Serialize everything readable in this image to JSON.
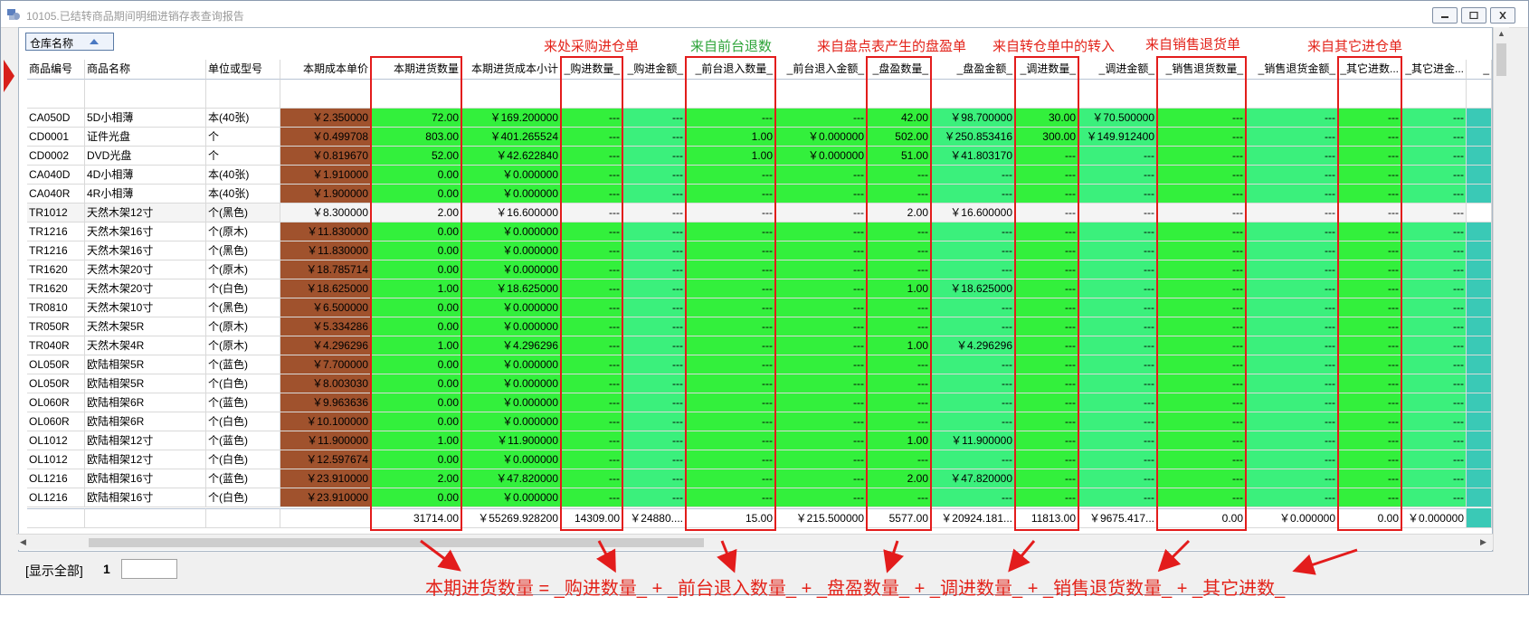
{
  "window": {
    "title": "10105.已结转商品期间明细进销存表查询报告"
  },
  "group_bar": {
    "label": "仓库名称"
  },
  "columns": [
    "商品编号",
    "商品名称",
    "单位或型号",
    "本期成本单价",
    "本期进货数量",
    "本期进货成本小计",
    "_购进数量_",
    "_购进金额_",
    "_前台退入数量_",
    "_前台退入金额_",
    "_盘盈数量_",
    "_盘盈金额_",
    "_调进数量_",
    "_调进金额_",
    "_销售退货数量_",
    "_销售退货金额_",
    "_其它进数...",
    "_其它进金...",
    "_"
  ],
  "rows": [
    [
      "CA050D",
      "5D小相薄",
      "本(40张)",
      "￥2.350000",
      "72.00",
      "￥169.200000",
      "---",
      "---",
      "---",
      "---",
      "42.00",
      "￥98.700000",
      "30.00",
      "￥70.500000",
      "---",
      "---",
      "---",
      "---"
    ],
    [
      "CD0001",
      "证件光盘",
      "个",
      "￥0.499708",
      "803.00",
      "￥401.265524",
      "---",
      "---",
      "1.00",
      "￥0.000000",
      "502.00",
      "￥250.853416",
      "300.00",
      "￥149.912400",
      "---",
      "---",
      "---",
      "---"
    ],
    [
      "CD0002",
      "DVD光盘",
      "个",
      "￥0.819670",
      "52.00",
      "￥42.622840",
      "---",
      "---",
      "1.00",
      "￥0.000000",
      "51.00",
      "￥41.803170",
      "---",
      "---",
      "---",
      "---",
      "---",
      "---"
    ],
    [
      "CA040D",
      "4D小相薄",
      "本(40张)",
      "￥1.910000",
      "0.00",
      "￥0.000000",
      "---",
      "---",
      "---",
      "---",
      "---",
      "---",
      "---",
      "---",
      "---",
      "---",
      "---",
      "---"
    ],
    [
      "CA040R",
      "4R小相薄",
      "本(40张)",
      "￥1.900000",
      "0.00",
      "￥0.000000",
      "---",
      "---",
      "---",
      "---",
      "---",
      "---",
      "---",
      "---",
      "---",
      "---",
      "---",
      "---"
    ],
    [
      "TR1012",
      "天然木架12寸",
      "个(黑色)",
      "￥8.300000",
      "2.00",
      "￥16.600000",
      "---",
      "---",
      "---",
      "---",
      "2.00",
      "￥16.600000",
      "---",
      "---",
      "---",
      "---",
      "---",
      "---"
    ],
    [
      "TR1216",
      "天然木架16寸",
      "个(原木)",
      "￥11.830000",
      "0.00",
      "￥0.000000",
      "---",
      "---",
      "---",
      "---",
      "---",
      "---",
      "---",
      "---",
      "---",
      "---",
      "---",
      "---"
    ],
    [
      "TR1216",
      "天然木架16寸",
      "个(黑色)",
      "￥11.830000",
      "0.00",
      "￥0.000000",
      "---",
      "---",
      "---",
      "---",
      "---",
      "---",
      "---",
      "---",
      "---",
      "---",
      "---",
      "---"
    ],
    [
      "TR1620",
      "天然木架20寸",
      "个(原木)",
      "￥18.785714",
      "0.00",
      "￥0.000000",
      "---",
      "---",
      "---",
      "---",
      "---",
      "---",
      "---",
      "---",
      "---",
      "---",
      "---",
      "---"
    ],
    [
      "TR1620",
      "天然木架20寸",
      "个(白色)",
      "￥18.625000",
      "1.00",
      "￥18.625000",
      "---",
      "---",
      "---",
      "---",
      "1.00",
      "￥18.625000",
      "---",
      "---",
      "---",
      "---",
      "---",
      "---"
    ],
    [
      "TR0810",
      "天然木架10寸",
      "个(黑色)",
      "￥6.500000",
      "0.00",
      "￥0.000000",
      "---",
      "---",
      "---",
      "---",
      "---",
      "---",
      "---",
      "---",
      "---",
      "---",
      "---",
      "---"
    ],
    [
      "TR050R",
      "天然木架5R",
      "个(原木)",
      "￥5.334286",
      "0.00",
      "￥0.000000",
      "---",
      "---",
      "---",
      "---",
      "---",
      "---",
      "---",
      "---",
      "---",
      "---",
      "---",
      "---"
    ],
    [
      "TR040R",
      "天然木架4R",
      "个(原木)",
      "￥4.296296",
      "1.00",
      "￥4.296296",
      "---",
      "---",
      "---",
      "---",
      "1.00",
      "￥4.296296",
      "---",
      "---",
      "---",
      "---",
      "---",
      "---"
    ],
    [
      "OL050R",
      "欧陆相架5R",
      "个(蓝色)",
      "￥7.700000",
      "0.00",
      "￥0.000000",
      "---",
      "---",
      "---",
      "---",
      "---",
      "---",
      "---",
      "---",
      "---",
      "---",
      "---",
      "---"
    ],
    [
      "OL050R",
      "欧陆相架5R",
      "个(白色)",
      "￥8.003030",
      "0.00",
      "￥0.000000",
      "---",
      "---",
      "---",
      "---",
      "---",
      "---",
      "---",
      "---",
      "---",
      "---",
      "---",
      "---"
    ],
    [
      "OL060R",
      "欧陆相架6R",
      "个(蓝色)",
      "￥9.963636",
      "0.00",
      "￥0.000000",
      "---",
      "---",
      "---",
      "---",
      "---",
      "---",
      "---",
      "---",
      "---",
      "---",
      "---",
      "---"
    ],
    [
      "OL060R",
      "欧陆相架6R",
      "个(白色)",
      "￥10.100000",
      "0.00",
      "￥0.000000",
      "---",
      "---",
      "---",
      "---",
      "---",
      "---",
      "---",
      "---",
      "---",
      "---",
      "---",
      "---"
    ],
    [
      "OL1012",
      "欧陆相架12寸",
      "个(蓝色)",
      "￥11.900000",
      "1.00",
      "￥11.900000",
      "---",
      "---",
      "---",
      "---",
      "1.00",
      "￥11.900000",
      "---",
      "---",
      "---",
      "---",
      "---",
      "---"
    ],
    [
      "OL1012",
      "欧陆相架12寸",
      "个(白色)",
      "￥12.597674",
      "0.00",
      "￥0.000000",
      "---",
      "---",
      "---",
      "---",
      "---",
      "---",
      "---",
      "---",
      "---",
      "---",
      "---",
      "---"
    ],
    [
      "OL1216",
      "欧陆相架16寸",
      "个(蓝色)",
      "￥23.910000",
      "2.00",
      "￥47.820000",
      "---",
      "---",
      "---",
      "---",
      "2.00",
      "￥47.820000",
      "---",
      "---",
      "---",
      "---",
      "---",
      "---"
    ],
    [
      "OL1216",
      "欧陆相架16寸",
      "个(白色)",
      "￥23.910000",
      "0.00",
      "￥0.000000",
      "---",
      "---",
      "---",
      "---",
      "---",
      "---",
      "---",
      "---",
      "---",
      "---",
      "---",
      "---"
    ]
  ],
  "totals": [
    "",
    "",
    "",
    "",
    "31714.00",
    "￥55269.928200",
    "14309.00",
    "￥24880....",
    "15.00",
    "￥215.500000",
    "5577.00",
    "￥20924.181...",
    "11813.00",
    "￥9675.417...",
    "0.00",
    "￥0.000000",
    "0.00",
    "￥0.000000"
  ],
  "footer": {
    "show_all": "[显示全部]",
    "page": "1"
  },
  "annotations": {
    "purchase": "来处采购进仓单",
    "front_return": "来自前台退数",
    "inventory_gain": "来自盘点表产生的盘盈单",
    "transfer_in": "来自转仓单中的转入",
    "sales_return": "来自销售退货单",
    "other_in": "来自其它进仓单",
    "formula": "本期进货数量 = _购进数量_ + _前台退入数量_ + _盘盈数量_ + _调进数量_ + _销售退货数量_ + _其它进数_"
  },
  "colors": {
    "green": "#33f03c",
    "teal_green": "#3bf07c",
    "brown": "#a0522d",
    "teal": "#3ac9b6",
    "red": "#e31c1c"
  }
}
